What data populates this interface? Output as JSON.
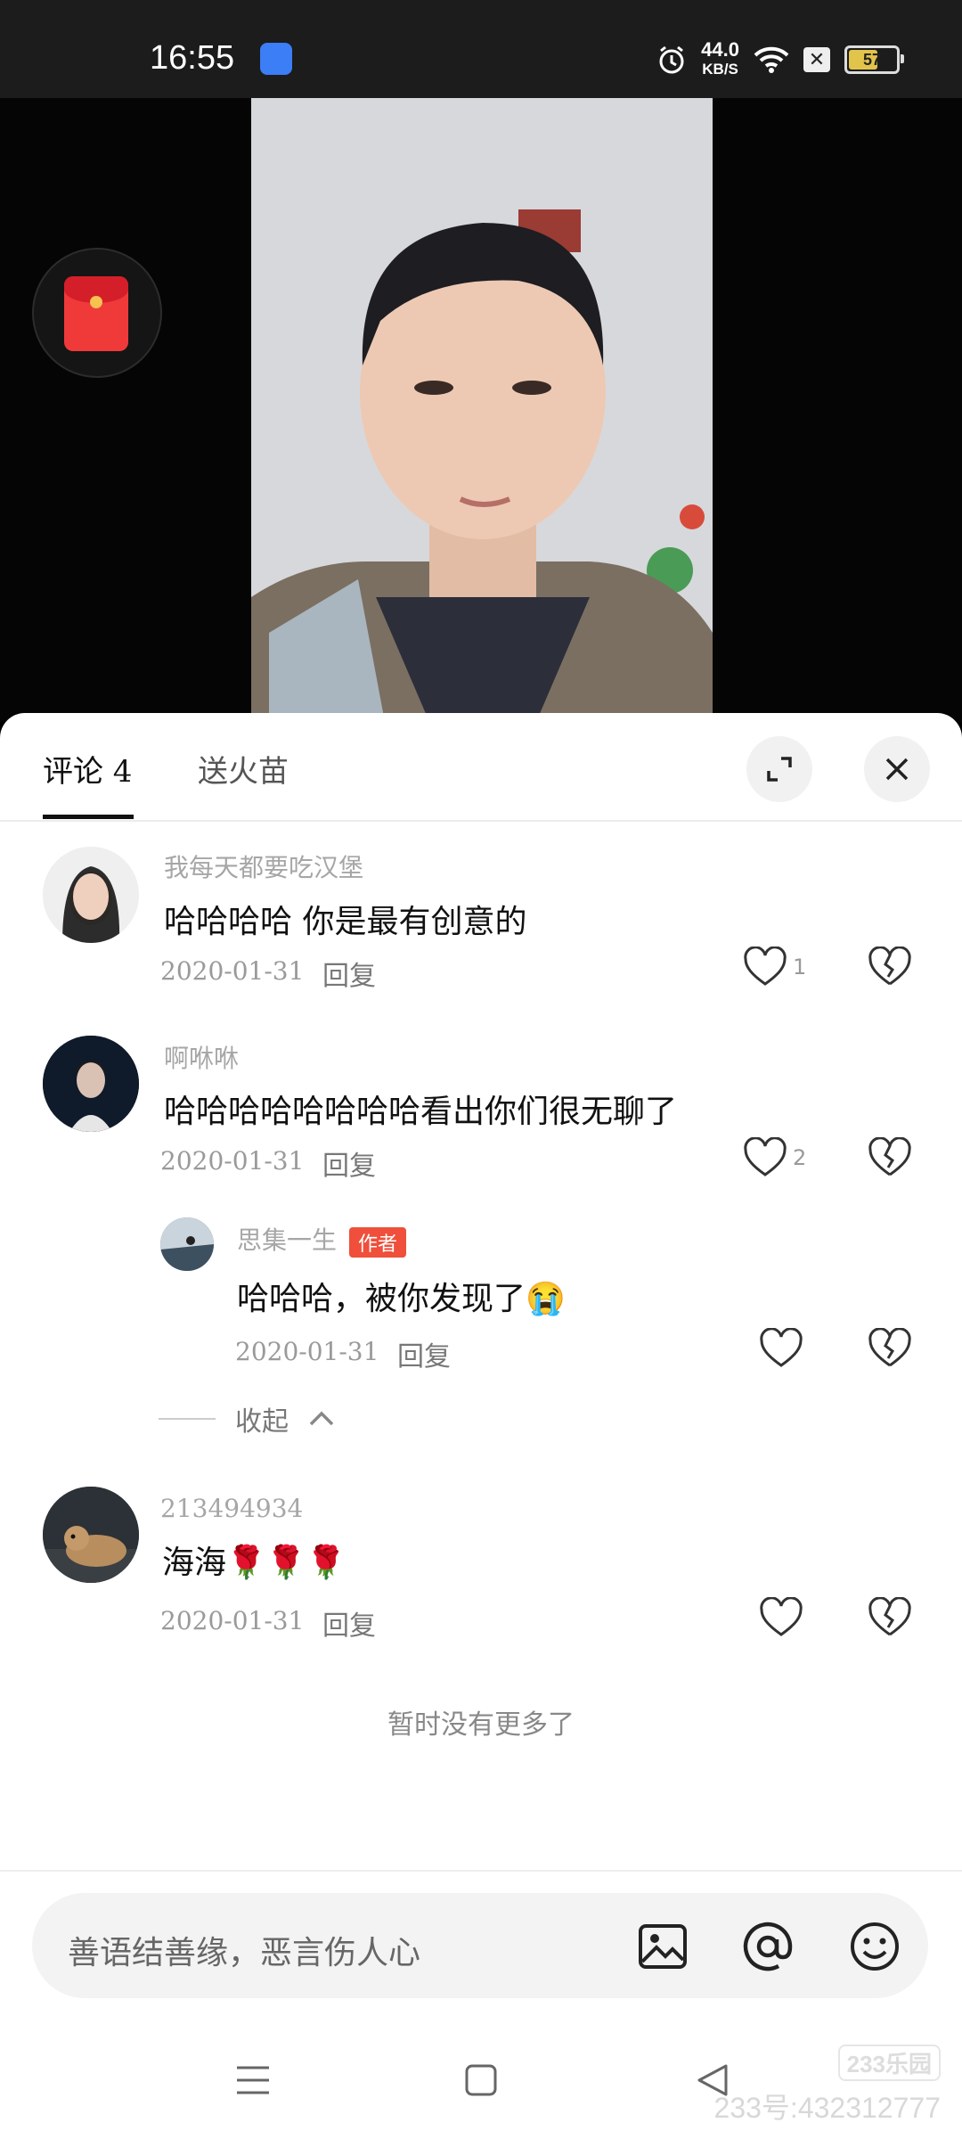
{
  "status_bar": {
    "time": "16:55",
    "net_speed_value": "44.0",
    "net_speed_unit": "KB/S",
    "battery": "57"
  },
  "comments_panel": {
    "tabs": [
      {
        "label": "评论 4"
      },
      {
        "label": "送火苗"
      }
    ],
    "comments": [
      {
        "username": "我每天都要吃汉堡",
        "text": "哈哈哈哈 你是最有创意的",
        "date": "2020-01-31",
        "reply_label": "回复",
        "likes": "1"
      },
      {
        "username": "啊咻咻",
        "text": "哈哈哈哈哈哈哈哈看出你们很无聊了",
        "date": "2020-01-31",
        "reply_label": "回复",
        "likes": "2",
        "replies": [
          {
            "username": "思集一生",
            "badge": "作者",
            "text": "哈哈哈，被你发现了😭",
            "date": "2020-01-31",
            "reply_label": "回复"
          }
        ]
      },
      {
        "username": "213494934",
        "text": "海海🌹🌹🌹",
        "date": "2020-01-31",
        "reply_label": "回复"
      }
    ],
    "collapse_label": "收起",
    "no_more_text": "暂时没有更多了"
  },
  "input_bar": {
    "placeholder": "善语结善缘，恶言伤人心"
  },
  "watermark": {
    "logo": "233乐园",
    "text": "233号:432312777"
  },
  "colors": {
    "author_badge": "#ef4f3b",
    "red_packet": "#f03a3a"
  }
}
